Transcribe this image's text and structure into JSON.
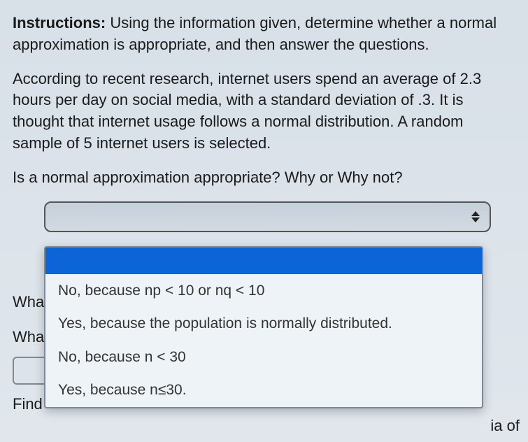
{
  "instructions": {
    "label": "Instructions:",
    "text": "Using the information given, determine whether a normal approximation is appropriate, and then answer the questions."
  },
  "context": "According to recent research, internet users spend an average of 2.3 hours per day on social media, with a standard deviation of .3. It is thought that internet usage follows a normal distribution. A random sample of 5 internet users is selected.",
  "question": "Is a normal approximation appropriate? Why or Why not?",
  "dropdown": {
    "selected": "",
    "options": [
      "",
      "No, because np < 10 or nq < 10",
      "Yes, because the population is normally distributed.",
      "No, because n < 30",
      "Yes, because n≤30."
    ]
  },
  "behind": {
    "row1": "Wha",
    "row2": "Wha",
    "find": "Find"
  },
  "trailing": "ia of"
}
